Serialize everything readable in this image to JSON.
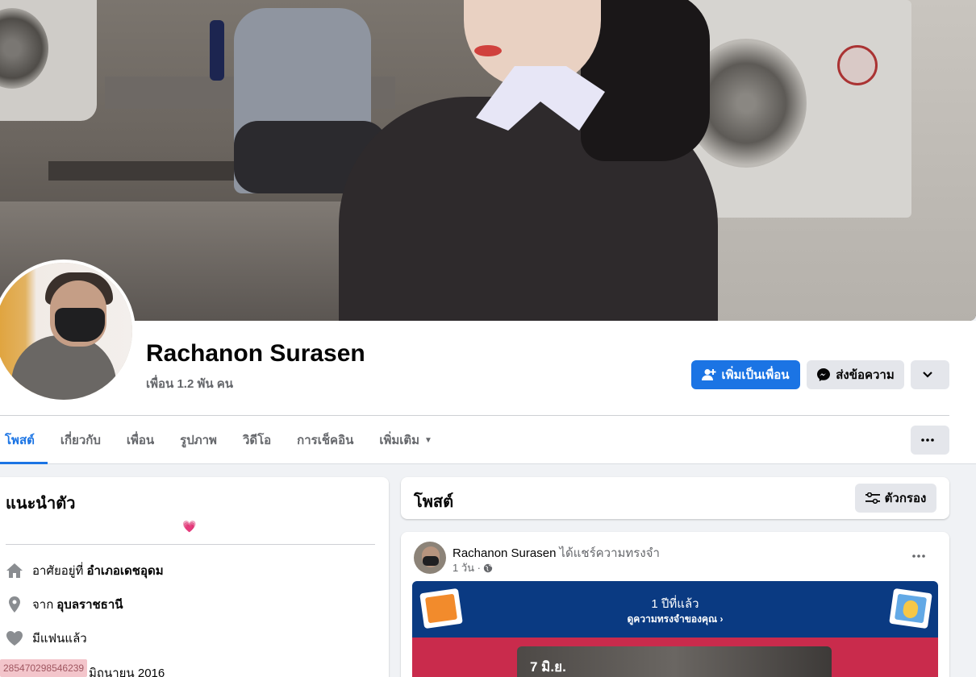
{
  "profile": {
    "name": "Rachanon Surasen",
    "friends": "เพื่อน 1.2 พัน คน"
  },
  "actions": {
    "add_friend": "เพิ่มเป็นเพื่อน",
    "message": "ส่งข้อความ"
  },
  "tabs": [
    {
      "label": "โพสต์",
      "active": true
    },
    {
      "label": "เกี่ยวกับ"
    },
    {
      "label": "เพื่อน"
    },
    {
      "label": "รูปภาพ"
    },
    {
      "label": "วิดีโอ"
    },
    {
      "label": "การเช็คอิน"
    },
    {
      "label": "เพิ่มเติม"
    }
  ],
  "intro": {
    "title": "แนะนำตัว",
    "bio_emoji": "💗",
    "lives_prefix": "อาศัยอยู่ที่",
    "lives_place": "อำเภอเดชอุดม",
    "from_prefix": "จาก",
    "from_place": "อุบลราชธานี",
    "relationship": "มีแฟนแล้ว",
    "joined_partial": "มิถุนายน 2016",
    "overlay_id": "285470298546239"
  },
  "posts": {
    "title": "โพสต์",
    "filter_label": "ตัวกรอง"
  },
  "post": {
    "author": "Rachanon Surasen",
    "action": "ได้แชร์ความทรงจำ",
    "time": "1 วัน ·",
    "memory_title": "1 ปีที่แล้ว",
    "memory_link": "ดูความทรงจำของคุณ",
    "photo_date": "7 มิ.ย."
  },
  "colors": {
    "primary": "#1b74e4",
    "memory_blue": "#0a3a82",
    "memory_red": "#c92b4c"
  }
}
